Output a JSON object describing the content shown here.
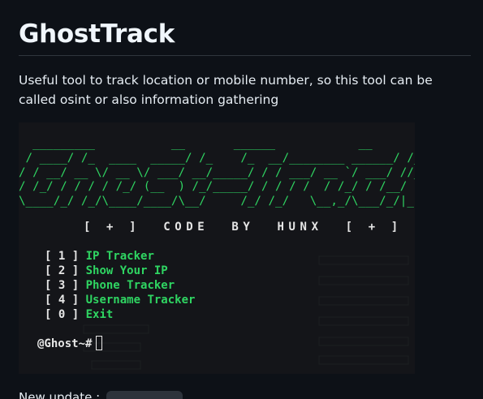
{
  "heading": "GhostTrack",
  "description": "Useful tool to track location or mobile number, so this tool can be called osint or also information gathering",
  "terminal": {
    "ascii_banner": "  _________           __       ______            __\n / ____/ /_  ____  _____/ /_    /_  __/________ ______/ /__\n/ / __/ __ \\/ __ \\/ ___/ __/_____/ / / ___/ __ `/ ___/ //_/\n/ /_/ / / / / /_/ (__  ) /_/_____/ / / / /  / /_/ / /__/ ,<\n\\____/_/ /_/\\____/____/\\__/     /_/ /_/   \\__,_/\\___/_/|_|",
    "credit": "[ + ]  CODE  BY  HUNX  [ + ]",
    "menu": [
      {
        "num": "[ 1 ]",
        "label": "IP Tracker"
      },
      {
        "num": "[ 2 ]",
        "label": "Show Your IP"
      },
      {
        "num": "[ 3 ]",
        "label": "Phone Tracker"
      },
      {
        "num": "[ 4 ]",
        "label": "Username Tracker"
      },
      {
        "num": "[ 0 ]",
        "label": "Exit"
      }
    ],
    "prompt": "@Ghost~#"
  },
  "next_section": {
    "text": "New update :"
  },
  "colors": {
    "page_bg": "#0d1117",
    "terminal_bg": "#141519",
    "accent_green": "#2fd562"
  }
}
